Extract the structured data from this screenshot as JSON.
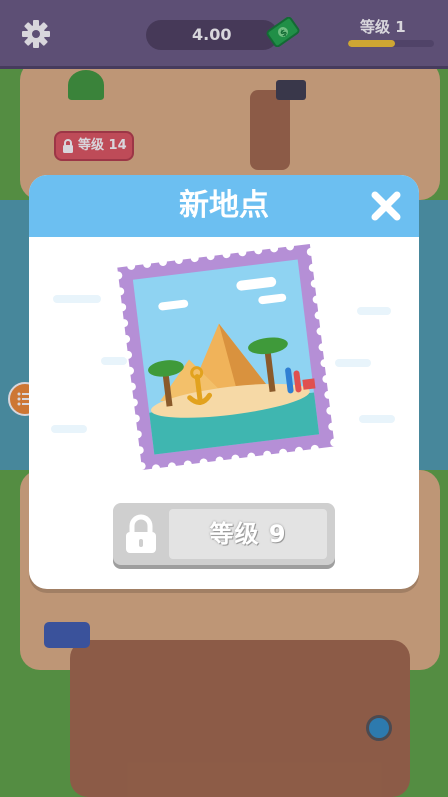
{
  "hud": {
    "money": "4.00",
    "level_label": "等级 1",
    "xp_progress": 0.55
  },
  "map": {
    "locked_area_label": "等级 14"
  },
  "modal": {
    "title": "新地点",
    "unlock_label": "等级 9"
  },
  "icons": {
    "settings": "gear-icon",
    "cash": "cash-icon",
    "close": "close-icon",
    "lock": "lock-icon",
    "list": "list-icon"
  },
  "colors": {
    "topbar": "#6a5b82",
    "modal_header": "#6cbff1",
    "xp_fill": "#f3c531",
    "side_button": "#f28a33",
    "lock_badge": "#e0565e"
  }
}
